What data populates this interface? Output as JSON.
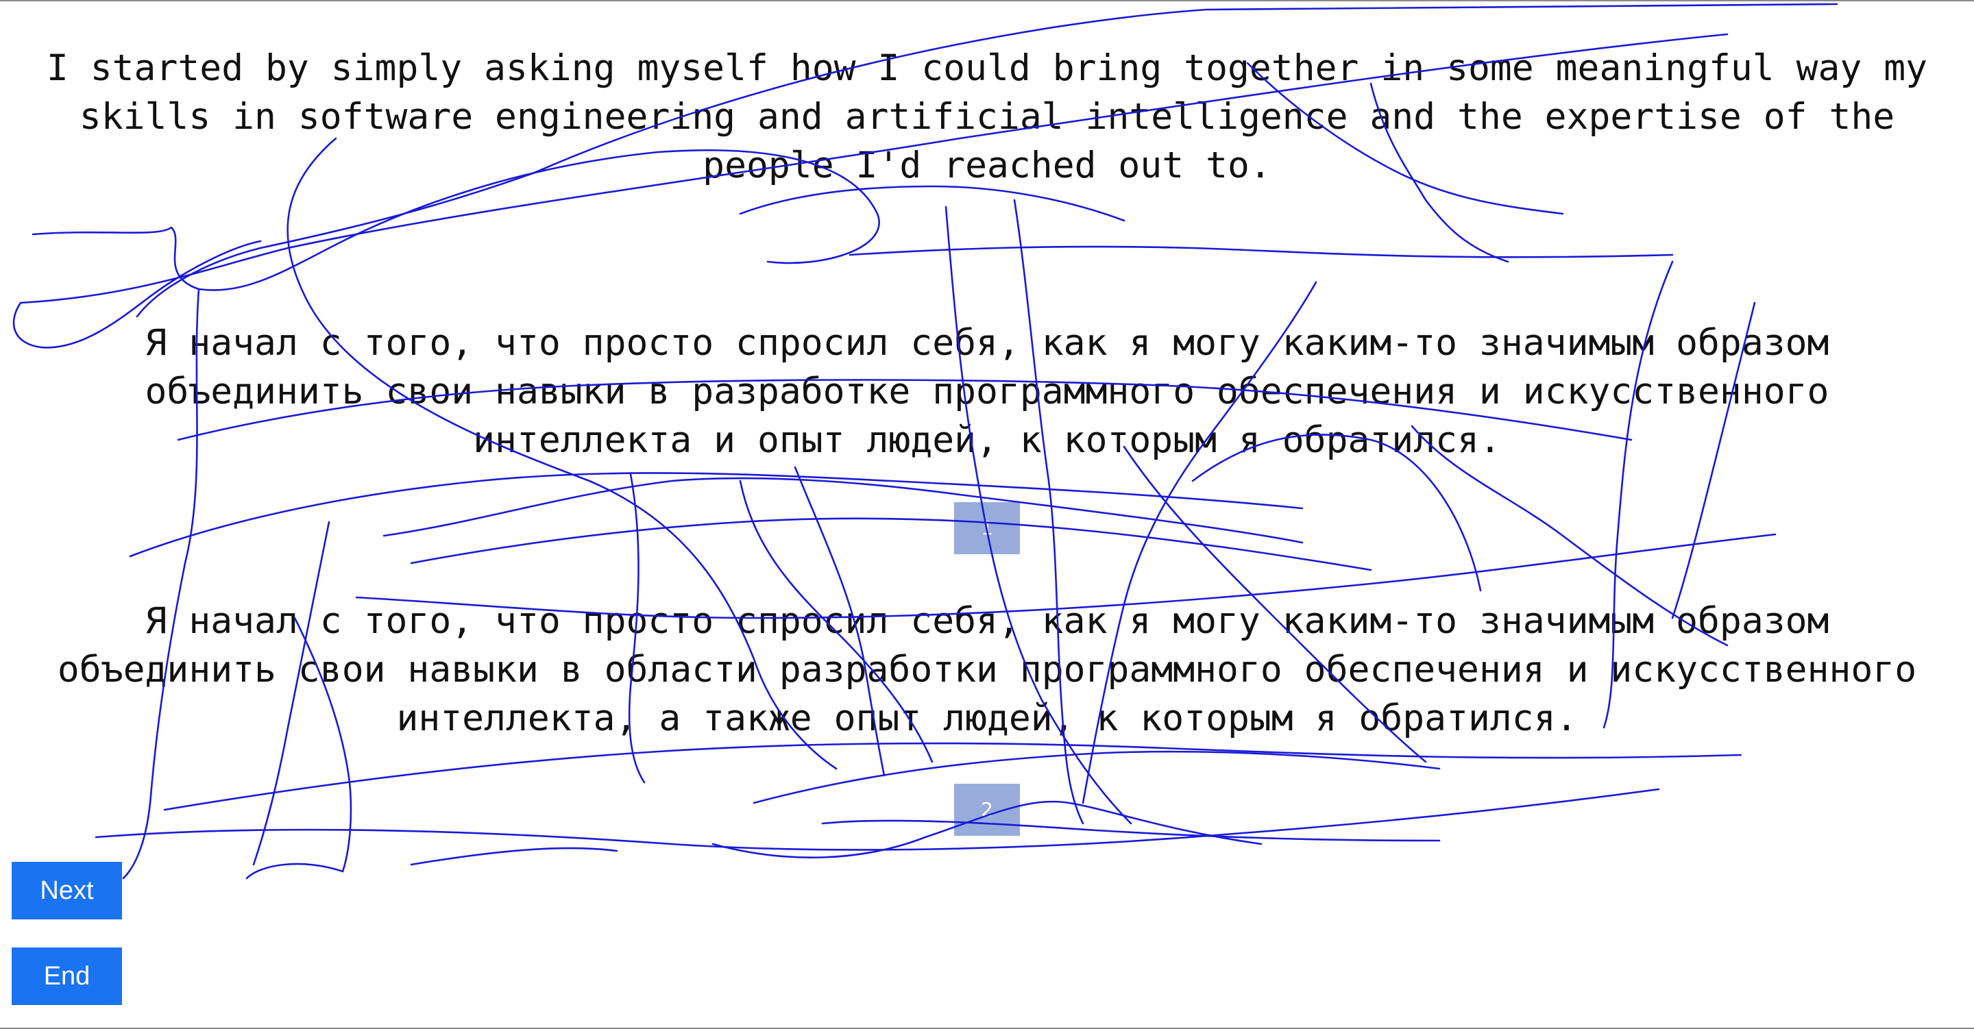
{
  "paragraphs": [
    {
      "id": "english",
      "text": "I started by simply asking myself how I could bring together in some meaningful way my\nskills in software engineering and artificial intelligence and the expertise of the\npeople I'd reached out to."
    },
    {
      "id": "russian-1",
      "text": "Я начал с того, что просто спросил себя, как я могу каким-то значимым образом\nобъединить свои навыки в разработке программного обеспечения и искусственного\nинтеллекта и опыт людей, к которым я обратился."
    },
    {
      "id": "russian-2",
      "text": "Я начал с того, что просто спросил себя, как я могу каким-то значимым образом\nобъединить свои навыки в области разработки программного обеспечения и искусственного\nинтеллекта, а также опыт людей, к которым я обратился."
    }
  ],
  "markers": [
    "1",
    "2"
  ],
  "buttons": {
    "next_label": "Next",
    "end_label": "End"
  },
  "colors": {
    "scribble_stroke": "#1a1ad6",
    "button_bg": "#1a73f0",
    "marker_bg": "#97acdb"
  }
}
